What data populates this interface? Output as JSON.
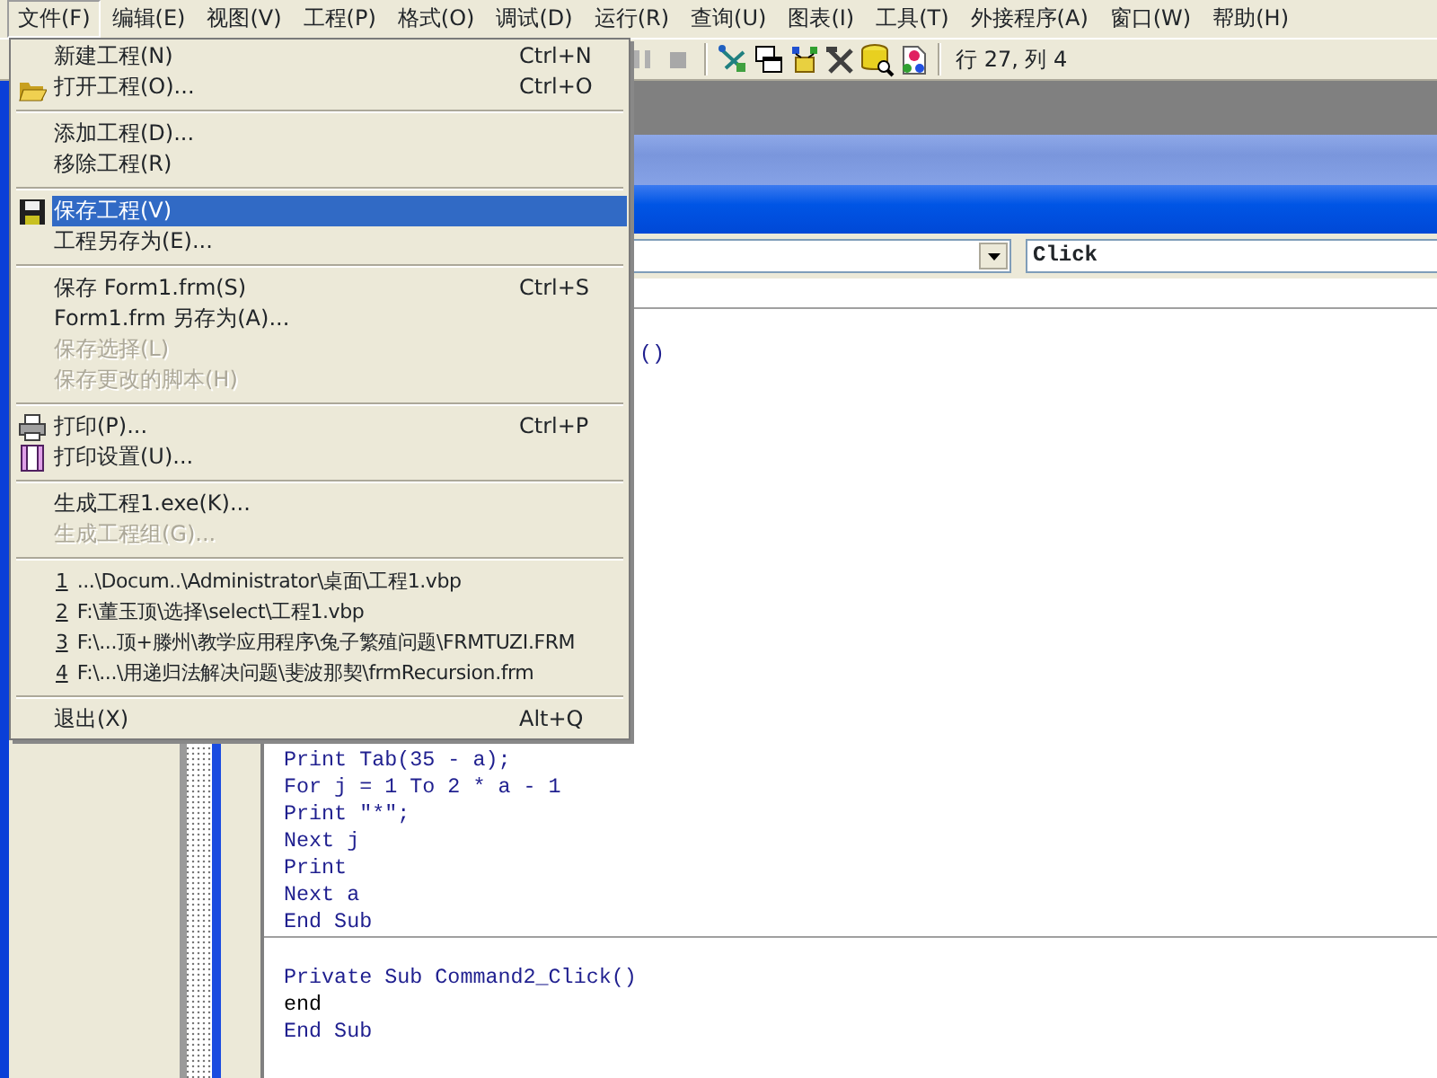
{
  "menubar": [
    {
      "label": "文件(F)",
      "selected": true
    },
    {
      "label": "编辑(E)",
      "selected": false
    },
    {
      "label": "视图(V)",
      "selected": false
    },
    {
      "label": "工程(P)",
      "selected": false
    },
    {
      "label": "格式(O)",
      "selected": false
    },
    {
      "label": "调试(D)",
      "selected": false
    },
    {
      "label": "运行(R)",
      "selected": false
    },
    {
      "label": "查询(U)",
      "selected": false
    },
    {
      "label": "图表(I)",
      "selected": false
    },
    {
      "label": "工具(T)",
      "selected": false
    },
    {
      "label": "外接程序(A)",
      "selected": false
    },
    {
      "label": "窗口(W)",
      "selected": false
    },
    {
      "label": "帮助(H)",
      "selected": false
    }
  ],
  "file_menu": {
    "items": [
      {
        "kind": "item",
        "label": "新建工程(N)",
        "shortcut": "Ctrl+N",
        "selected": false,
        "disabled": false
      },
      {
        "kind": "item",
        "label": "打开工程(O)...",
        "shortcut": "Ctrl+O",
        "selected": false,
        "disabled": false
      },
      {
        "kind": "separator"
      },
      {
        "kind": "item",
        "label": "添加工程(D)...",
        "selected": false,
        "disabled": false
      },
      {
        "kind": "item",
        "label": "移除工程(R)",
        "selected": false,
        "disabled": false
      },
      {
        "kind": "separator"
      },
      {
        "kind": "item",
        "label": "保存工程(V)",
        "selected": true,
        "disabled": false
      },
      {
        "kind": "item",
        "label": "工程另存为(E)...",
        "selected": false,
        "disabled": false
      },
      {
        "kind": "separator"
      },
      {
        "kind": "item",
        "label": "保存 Form1.frm(S)",
        "shortcut": "Ctrl+S",
        "selected": false,
        "disabled": false
      },
      {
        "kind": "item",
        "label": "Form1.frm 另存为(A)...",
        "selected": false,
        "disabled": false
      },
      {
        "kind": "item",
        "label": "保存选择(L)",
        "selected": false,
        "disabled": true
      },
      {
        "kind": "item",
        "label": "保存更改的脚本(H)",
        "selected": false,
        "disabled": true
      },
      {
        "kind": "separator"
      },
      {
        "kind": "item",
        "label": "打印(P)...",
        "shortcut": "Ctrl+P",
        "selected": false,
        "disabled": false
      },
      {
        "kind": "item",
        "label": "打印设置(U)...",
        "selected": false,
        "disabled": false
      },
      {
        "kind": "separator"
      },
      {
        "kind": "item",
        "label": "生成工程1.exe(K)...",
        "selected": false,
        "disabled": false
      },
      {
        "kind": "item",
        "label": "生成工程组(G)...",
        "selected": false,
        "disabled": true
      },
      {
        "kind": "separator"
      },
      {
        "kind": "recent",
        "number": "1",
        "path": "...\\Docum..\\Administrator\\桌面\\工程1.vbp"
      },
      {
        "kind": "recent",
        "number": "2",
        "path": "F:\\董玉顶\\选择\\select\\工程1.vbp"
      },
      {
        "kind": "recent",
        "number": "3",
        "path": "F:\\...顶+滕州\\教学应用程序\\兔子繁殖问题\\FRMTUZI.FRM"
      },
      {
        "kind": "recent",
        "number": "4",
        "path": "F:\\...\\用递归法解决问题\\斐波那契\\frmRecursion.frm"
      },
      {
        "kind": "separator"
      },
      {
        "kind": "item",
        "label": "退出(X)",
        "shortcut": "Alt+Q",
        "selected": false,
        "disabled": false
      }
    ]
  },
  "toolbar": {
    "position": "行 27, 列 4"
  },
  "code_window": {
    "procedure_combo": "Click",
    "sections": [
      {
        "partial_line": "()",
        "lines": [
          {
            "kind": "keyword",
            "text": "Print Tab(35 - a);"
          },
          {
            "kind": "keyword",
            "text": "For j = 1 To 2 * a - 1"
          },
          {
            "kind": "keyword",
            "text": "Print \"*\";"
          },
          {
            "kind": "keyword",
            "text": "Next j"
          },
          {
            "kind": "keyword",
            "text": "Print"
          },
          {
            "kind": "keyword",
            "text": "Next a"
          },
          {
            "kind": "keyword",
            "text": "End Sub"
          }
        ]
      },
      {
        "lines": [
          {
            "kind": "keyword",
            "text": "Private Sub Command2_Click()"
          },
          {
            "kind": "plain",
            "text": "end"
          },
          {
            "kind": "keyword",
            "text": "End Sub"
          }
        ]
      }
    ]
  }
}
